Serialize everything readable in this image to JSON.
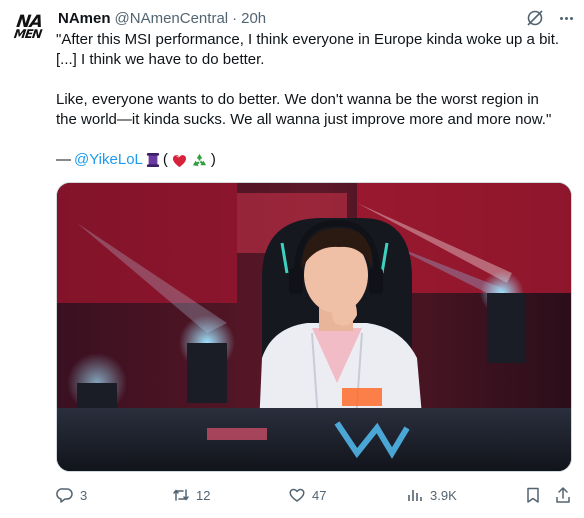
{
  "author": {
    "avatar_text_line1": "NA",
    "avatar_text_line2": "MEN",
    "name": "NAmen",
    "handle": "@NAmenCentral",
    "separator": "·",
    "time": "20h"
  },
  "tweet": {
    "paragraph1": "\"After this MSI performance, I think everyone in Europe kinda woke up a bit.\n[...] I think we have to do better.",
    "paragraph2": "Like, everyone wants to do better. We don't wanna be the worst region in\nthe world—it kinda sucks. We all wanna just improve more and more now.\"",
    "credit_dash": "—",
    "mention": "@YikeLoL",
    "paren_open": "(",
    "paren_close": ")",
    "emojis": [
      "scroll-emoji",
      "heart-emoji",
      "recycle-emoji"
    ]
  },
  "actions": {
    "replies": "3",
    "reposts": "12",
    "likes": "47",
    "views": "3.9K"
  },
  "colors": {
    "text": "#0f1419",
    "secondary": "#536471",
    "link": "#1d9bf0"
  }
}
